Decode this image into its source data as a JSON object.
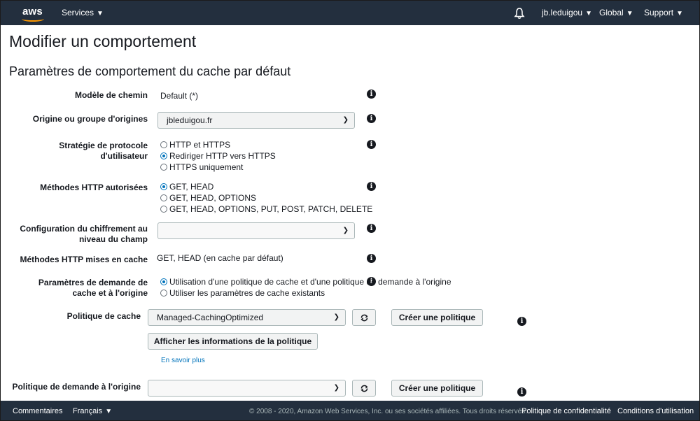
{
  "topbar": {
    "logo": "aws",
    "services": "Services",
    "user": "jb.leduigou",
    "region": "Global",
    "support": "Support"
  },
  "page": {
    "title": "Modifier un comportement",
    "section_title": "Paramètres de comportement du cache par défaut"
  },
  "form": {
    "path_pattern": {
      "label": "Modèle de chemin",
      "value": "Default (*)"
    },
    "origin": {
      "label": "Origine ou groupe d'origines",
      "value": "jbleduigou.fr"
    },
    "protocol_policy": {
      "label_line1": "Stratégie de protocole",
      "label_line2": "d'utilisateur",
      "options": [
        "HTTP et HTTPS",
        "Rediriger HTTP vers HTTPS",
        "HTTPS uniquement"
      ],
      "selected": 1
    },
    "allowed_methods": {
      "label": "Méthodes HTTP autorisées",
      "options": [
        "GET, HEAD",
        "GET, HEAD, OPTIONS",
        "GET, HEAD, OPTIONS, PUT, POST, PATCH, DELETE"
      ],
      "selected": 0
    },
    "field_encryption": {
      "label_line1": "Configuration du chiffrement au",
      "label_line2": "niveau du champ",
      "value": ""
    },
    "cached_methods": {
      "label": "Méthodes HTTP mises en cache",
      "value": "GET, HEAD (en cache par défaut)"
    },
    "cache_request_settings": {
      "label_line1": "Paramètres de demande de",
      "label_line2": "cache et à l'origine",
      "options": [
        "Utilisation d'une politique de cache et d'une politique de demande à l'origine",
        "Utiliser les paramètres de cache existants"
      ],
      "selected": 0
    },
    "cache_policy": {
      "label": "Politique de cache",
      "value": "Managed-CachingOptimized",
      "create_button": "Créer une politique",
      "details_button": "Afficher les informations de la politique",
      "learn_more": "En savoir plus"
    },
    "origin_request_policy": {
      "label": "Politique de demande à l'origine",
      "value": "",
      "create_button": "Créer une politique"
    }
  },
  "footer": {
    "feedback": "Commentaires",
    "language": "Français",
    "copyright": "© 2008 - 2020, Amazon Web Services, Inc. ou ses sociétés affiliées. Tous droits réservés.",
    "privacy": "Politique de confidentialité",
    "terms": "Conditions d'utilisation"
  },
  "colors": {
    "topbar": "#232f3e",
    "accent": "#ff9900",
    "link": "#0073bb"
  }
}
